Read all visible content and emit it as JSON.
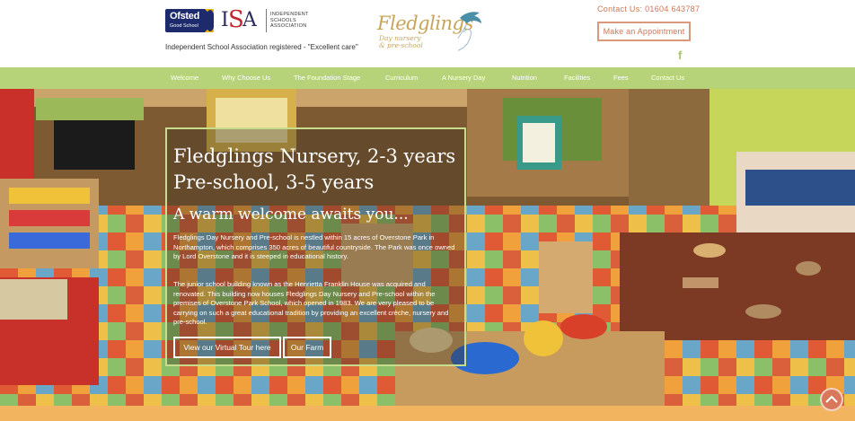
{
  "header": {
    "ofsted": {
      "word": "Ofsted",
      "grade": "Good School"
    },
    "isa": {
      "letters": [
        "I",
        "S",
        "A"
      ],
      "line1": "INDEPENDENT",
      "line2": "SCHOOLS",
      "line3": "ASSOCIATION"
    },
    "isa_note": "Independent School Association registered - \"Excellent care\"",
    "logo": {
      "name": "Fledglings",
      "sub1": "Day nursery",
      "sub2": "& pre-school"
    },
    "contact": "Contact Us: 01604 643787",
    "appointment_label": "Make an Appointment",
    "facebook_glyph": "f"
  },
  "nav": {
    "items": [
      "Welcome",
      "Why Choose Us",
      "The Foundation Stage",
      "Curriculum",
      "A Nursery Day",
      "Nutrition",
      "Facilities",
      "Fees",
      "Contact Us"
    ]
  },
  "hero": {
    "title_line1": "Fledglings Nursery, 2-3 years",
    "title_line2": "Pre-school, 3-5 years",
    "subtitle": "A warm welcome awaits you...",
    "para1": "Fledglings Day Nursery and Pre-school is nestled within 15 acres of Overstone Park in Northampton, which comprises 350 acres of beautiful countryside. The Park was once owned by Lord Overstone and it is steeped in educational history.",
    "para2": "The junior school building known as the Henrietta Franklin House was acquired and renovated. This building now houses Fledglings Day Nursery and Pre-school within the premises of Overstone Park School, which opened in 1983. We are very pleased to be carrying on such a great educational tradition by providing an excellent crèche, nursery and pre-school.",
    "tour_button": "View our Virtual Tour here",
    "farm_button": "Our Farm"
  },
  "colors": {
    "nav_green": "#b7d37a",
    "accent_orange": "#c8785a",
    "logo_gold": "#c8a45a",
    "footer_orange": "#f2b45f"
  },
  "icons": {
    "scroll_top": "chevron-up-icon",
    "facebook": "facebook-icon",
    "bird": "swallow-icon"
  }
}
